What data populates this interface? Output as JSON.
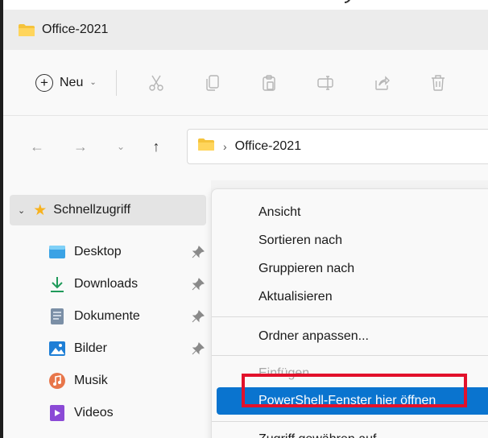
{
  "window": {
    "title": "Office-2021"
  },
  "toolbar": {
    "new_label": "Neu",
    "icons": [
      "cut-icon",
      "copy-icon",
      "paste-icon",
      "rename-icon",
      "share-icon",
      "delete-icon"
    ]
  },
  "address": {
    "path": "Office-2021"
  },
  "nav": {
    "quick_access": "Schnellzugriff",
    "items": [
      {
        "label": "Desktop",
        "icon": "desktop-icon",
        "pinned": true
      },
      {
        "label": "Downloads",
        "icon": "download-icon",
        "pinned": true
      },
      {
        "label": "Dokumente",
        "icon": "documents-icon",
        "pinned": true
      },
      {
        "label": "Bilder",
        "icon": "pictures-icon",
        "pinned": true
      },
      {
        "label": "Musik",
        "icon": "music-icon",
        "pinned": false
      },
      {
        "label": "Videos",
        "icon": "videos-icon",
        "pinned": false
      }
    ]
  },
  "context_menu": {
    "items": [
      {
        "label": "Ansicht"
      },
      {
        "label": "Sortieren nach"
      },
      {
        "label": "Gruppieren nach"
      },
      {
        "label": "Aktualisieren"
      },
      {
        "label": "Ordner anpassen..."
      },
      {
        "label": "Einfügen",
        "disabled": true
      },
      {
        "label": "PowerShell-Fenster hier öffnen",
        "selected": true
      },
      {
        "label": "Zugriff gewähren auf"
      }
    ]
  },
  "colors": {
    "accent": "#0a74cf",
    "highlight": "#e2112b",
    "star": "#f7b21e",
    "folder": "#f5c33b"
  }
}
